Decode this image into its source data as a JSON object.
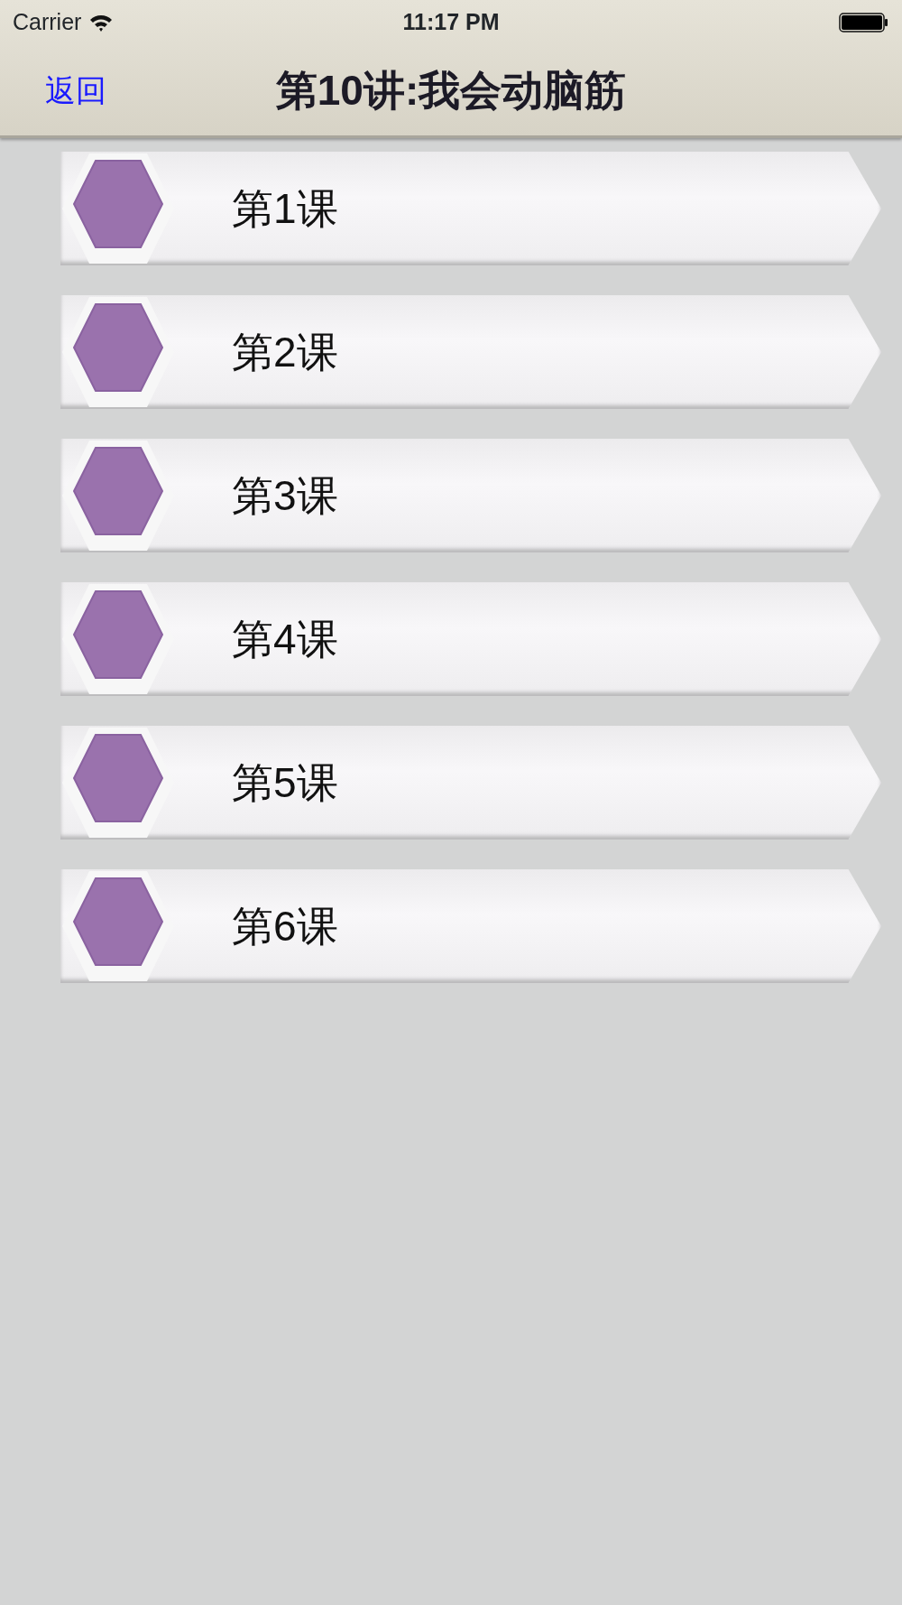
{
  "status_bar": {
    "carrier": "Carrier",
    "time": "11:17 PM"
  },
  "nav_bar": {
    "back": "返回",
    "title": "第10讲:我会动脑筋"
  },
  "lessons": [
    {
      "label": "第1课"
    },
    {
      "label": "第2课"
    },
    {
      "label": "第3课"
    },
    {
      "label": "第4课"
    },
    {
      "label": "第5课"
    },
    {
      "label": "第6课"
    }
  ]
}
